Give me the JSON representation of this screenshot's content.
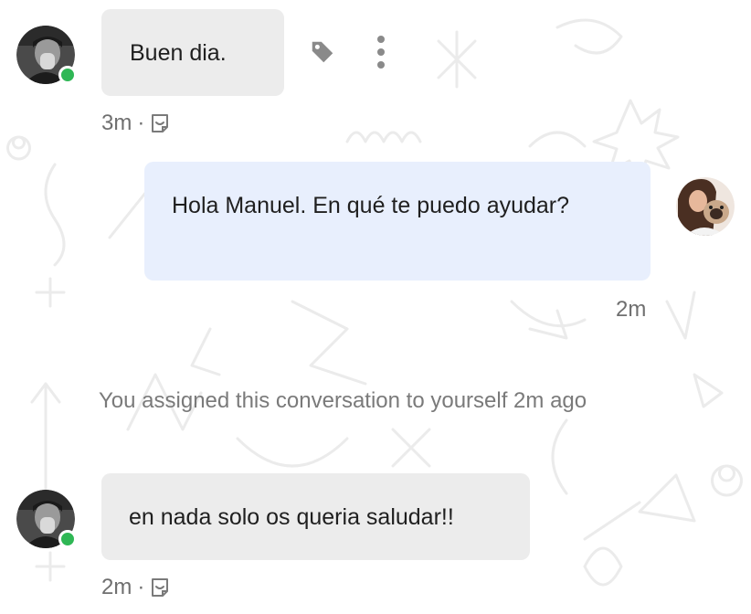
{
  "messages": [
    {
      "id": "m1",
      "direction": "incoming",
      "text": "Buen dia.",
      "time": "3m",
      "separator": "·",
      "note_icon": "note-icon",
      "presence": "online",
      "avatar_icon": "customer-avatar"
    },
    {
      "id": "m2",
      "direction": "outgoing",
      "text": "Hola Manuel. En qué te puedo ayudar?",
      "time": "2m",
      "avatar_icon": "agent-avatar"
    },
    {
      "id": "m3",
      "direction": "incoming",
      "text": "en nada solo os queria saludar!!",
      "time": "2m",
      "separator": "·",
      "note_icon": "note-icon",
      "presence": "online",
      "avatar_icon": "customer-avatar"
    }
  ],
  "event": {
    "text": "You assigned this conversation to yourself 2m ago"
  },
  "actions": {
    "tag_icon": "tag-icon",
    "more_icon": "more-vertical-icon"
  },
  "colors": {
    "incoming_bubble": "#ececec",
    "outgoing_bubble": "#e8effd",
    "presence_online": "#2fb755",
    "meta_text": "#6f6f6f",
    "doodle_stroke": "#ececec"
  }
}
